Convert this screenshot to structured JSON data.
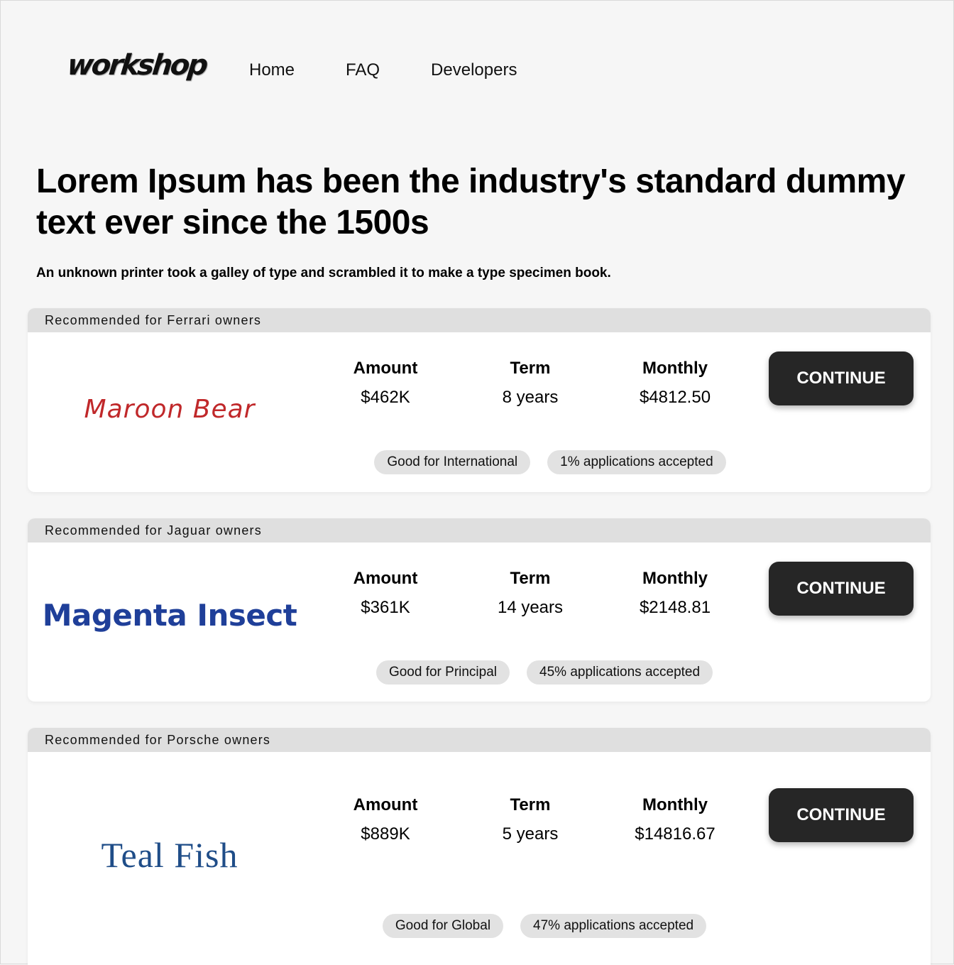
{
  "header": {
    "logo": "workshop",
    "nav": [
      "Home",
      "FAQ",
      "Developers"
    ]
  },
  "hero": {
    "title": "Lorem Ipsum has been the industry's standard dummy text ever since the 1500s",
    "subtitle": "An unknown printer took a galley of type and scrambled it to make a type specimen book."
  },
  "cards": [
    {
      "header": "Recommended for Ferrari owners",
      "brand": "Maroon Bear",
      "amount_label": "Amount",
      "amount": "$462K",
      "term_label": "Term",
      "term": "8 years",
      "monthly_label": "Monthly",
      "monthly": "$4812.50",
      "button": "CONTINUE",
      "tags": [
        "Good for International",
        "1% applications accepted"
      ]
    },
    {
      "header": "Recommended for Jaguar owners",
      "brand": "Magenta Insect",
      "amount_label": "Amount",
      "amount": "$361K",
      "term_label": "Term",
      "term": "14 years",
      "monthly_label": "Monthly",
      "monthly": "$2148.81",
      "button": "CONTINUE",
      "tags": [
        "Good for Principal",
        "45% applications accepted"
      ]
    },
    {
      "header": "Recommended for Porsche owners",
      "brand": "Teal Fish",
      "amount_label": "Amount",
      "amount": "$889K",
      "term_label": "Term",
      "term": "5 years",
      "monthly_label": "Monthly",
      "monthly": "$14816.67",
      "button": "CONTINUE",
      "tags": [
        "Good for Global",
        "47% applications accepted"
      ]
    }
  ],
  "colors": {
    "background": "#f6f6f6",
    "card_header": "#dfdfdf",
    "button": "#262626",
    "tag": "#e2e2e2",
    "maroon_bear": "#c0282a",
    "magenta_insect": "#1f3f99",
    "teal_fish": "#1f4d88"
  }
}
